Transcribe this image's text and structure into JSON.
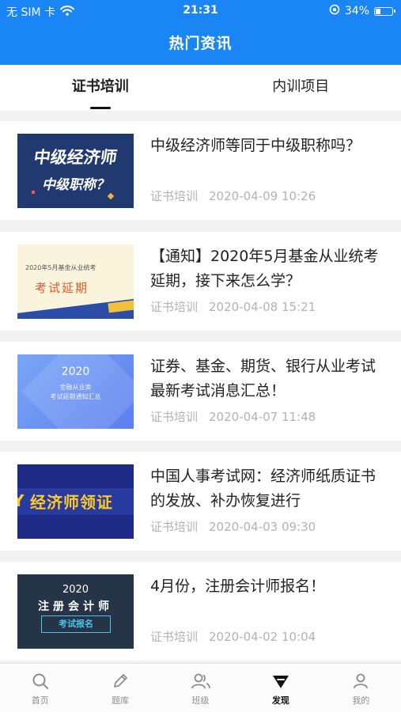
{
  "status": {
    "carrier": "无 SIM 卡",
    "time": "21:31",
    "battery": "34%",
    "battery_level": 0.34
  },
  "header": {
    "title": "热门资讯"
  },
  "tabs": [
    {
      "label": "证书培训",
      "active": true
    },
    {
      "label": "内训项目",
      "active": false
    }
  ],
  "articles": [
    {
      "title": "中级经济师等同于中级职称吗？",
      "category": "证书培训",
      "datetime": "2020-04-09 10:26",
      "thumb": {
        "line1": "中级经济师",
        "line2": "中级职称？"
      }
    },
    {
      "title": "【通知】2020年5月基金从业统考延期，接下来怎么学？",
      "category": "证书培训",
      "datetime": "2020-04-08 15:21",
      "thumb": {
        "line1": "2020年5月基金从业统考",
        "line2": "考试延期"
      }
    },
    {
      "title": "证券、基金、期货、银行从业考试最新考试消息汇总！",
      "category": "证书培训",
      "datetime": "2020-04-07 11:48",
      "thumb": {
        "line1": "2020",
        "line2": "金融从业类\n考试延期通知汇总"
      }
    },
    {
      "title": "中国人事考试网：经济师纸质证书的发放、补办恢复进行",
      "category": "证书培训",
      "datetime": "2020-04-03 09:30",
      "thumb": {
        "line1": "经济师领证",
        "side": "Y"
      }
    },
    {
      "title": "4月份，注册会计师报名！",
      "category": "证书培训",
      "datetime": "2020-04-02 10:04",
      "thumb": {
        "line1": "2020",
        "line2": "注册会计师",
        "line3": "考试报名"
      }
    }
  ],
  "tabbar": [
    {
      "label": "首页",
      "icon": "search-icon",
      "active": false
    },
    {
      "label": "题库",
      "icon": "pencil-icon",
      "active": false
    },
    {
      "label": "班级",
      "icon": "users-icon",
      "active": false
    },
    {
      "label": "发现",
      "icon": "discover-icon",
      "active": true
    },
    {
      "label": "我的",
      "icon": "person-icon",
      "active": false
    }
  ],
  "colors": {
    "brand": "#1a86f5",
    "meta_text": "#b2b2b2"
  }
}
